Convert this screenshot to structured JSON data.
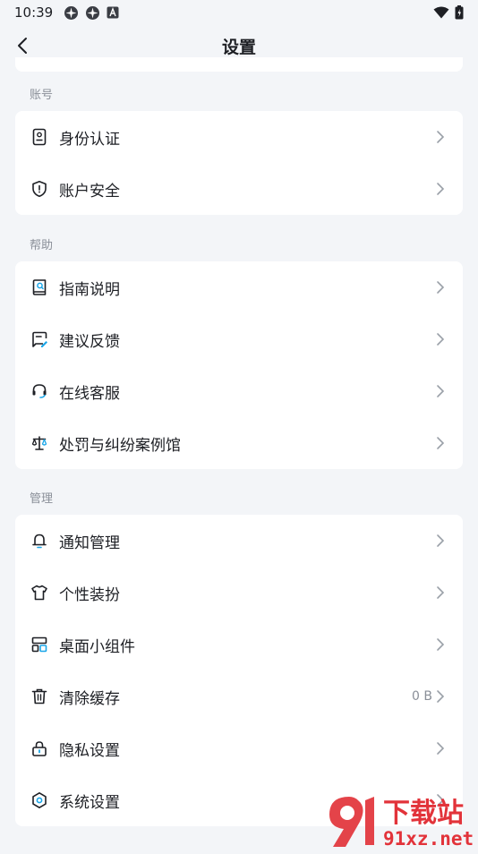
{
  "status_bar": {
    "time": "10:39"
  },
  "header": {
    "title": "设置"
  },
  "sections": [
    {
      "label": "账号",
      "items": [
        {
          "label": "身份认证",
          "icon": "id-card-icon"
        },
        {
          "label": "账户安全",
          "icon": "shield-icon"
        }
      ]
    },
    {
      "label": "帮助",
      "items": [
        {
          "label": "指南说明",
          "icon": "guide-book-icon"
        },
        {
          "label": "建议反馈",
          "icon": "feedback-icon"
        },
        {
          "label": "在线客服",
          "icon": "headset-icon"
        },
        {
          "label": "处罚与纠纷案例馆",
          "icon": "scale-icon"
        }
      ]
    },
    {
      "label": "管理",
      "items": [
        {
          "label": "通知管理",
          "icon": "bell-icon"
        },
        {
          "label": "个性装扮",
          "icon": "shirt-icon"
        },
        {
          "label": "桌面小组件",
          "icon": "widgets-icon"
        },
        {
          "label": "清除缓存",
          "icon": "trash-icon",
          "value": "0 B"
        },
        {
          "label": "隐私设置",
          "icon": "lock-icon"
        },
        {
          "label": "系统设置",
          "icon": "settings-gear-icon"
        }
      ]
    }
  ],
  "watermark": {
    "line1": "下载站",
    "line2": "91xz.net"
  },
  "colors": {
    "accent": "#1aa6e8",
    "watermark": "#e2333a",
    "background": "#f3f5f8"
  }
}
